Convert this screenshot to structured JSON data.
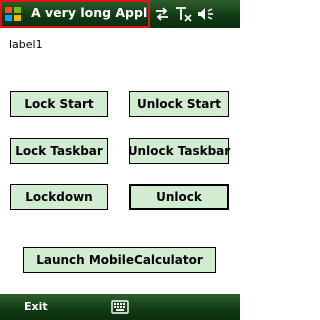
{
  "titlebar": {
    "title": "A very long Application title"
  },
  "main": {
    "label1": "label1"
  },
  "buttons": {
    "lock_start": "Lock Start",
    "unlock_start": "Unlock Start",
    "lock_taskbar": "Lock Taskbar",
    "unlock_taskbar": "Unlock Taskbar",
    "lockdown": "Lockdown",
    "unlock": "Unlock",
    "launch_calc": "Launch MobileCalculator"
  },
  "softkeys": {
    "left": "Exit"
  },
  "icons": {
    "start": "windows-start-icon",
    "connectivity": "connectivity-arrows-icon",
    "signal": "signal-off-icon",
    "volume": "volume-icon",
    "keyboard": "keyboard-icon"
  },
  "colors": {
    "bar_green": "#1d4a1f",
    "button_fill": "#d2ecd2",
    "title_highlight": "#e01414"
  }
}
